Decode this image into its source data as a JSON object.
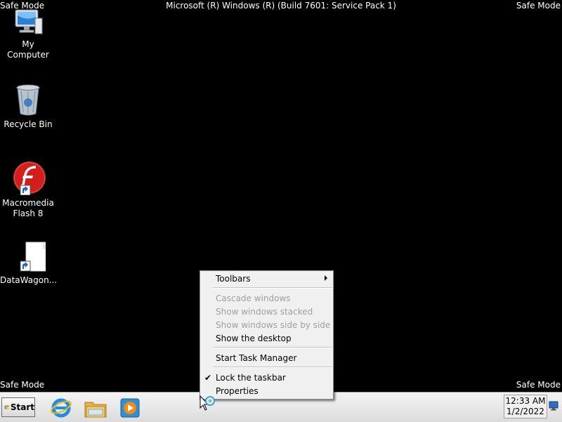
{
  "desktop": {
    "safe_mode_label": "Safe Mode",
    "banner": "Microsoft (R) Windows (R) (Build 7601: Service Pack 1)",
    "icons": [
      {
        "label": "My Computer",
        "icon": "computer-icon"
      },
      {
        "label": "Recycle Bin",
        "icon": "recycle-bin-icon"
      },
      {
        "label": "Macromedia Flash 8",
        "icon": "flash-shortcut-icon"
      },
      {
        "label": "DataWagon...",
        "icon": "document-shortcut-icon"
      }
    ]
  },
  "context_menu": {
    "items": [
      {
        "label": "Toolbars",
        "enabled": true,
        "submenu": true
      },
      {
        "label": "Cascade windows",
        "enabled": false
      },
      {
        "label": "Show windows stacked",
        "enabled": false
      },
      {
        "label": "Show windows side by side",
        "enabled": false
      },
      {
        "label": "Show the desktop",
        "enabled": true
      },
      {
        "label": "Start Task Manager",
        "enabled": true
      },
      {
        "label": "Lock the taskbar",
        "enabled": true,
        "checked": true
      },
      {
        "label": "Properties",
        "enabled": true
      }
    ],
    "check_mark": "✔"
  },
  "taskbar": {
    "start_label": "Start",
    "pinned": [
      "internet-explorer-icon",
      "windows-explorer-icon",
      "media-player-icon"
    ],
    "clock": {
      "time": "12:33 AM",
      "date": "1/2/2022"
    }
  },
  "colors": {
    "desktop": "#000000",
    "taskbar": "#e4e4e4",
    "menu": "#f0f0f0",
    "disabled_text": "#a0a0a0"
  }
}
